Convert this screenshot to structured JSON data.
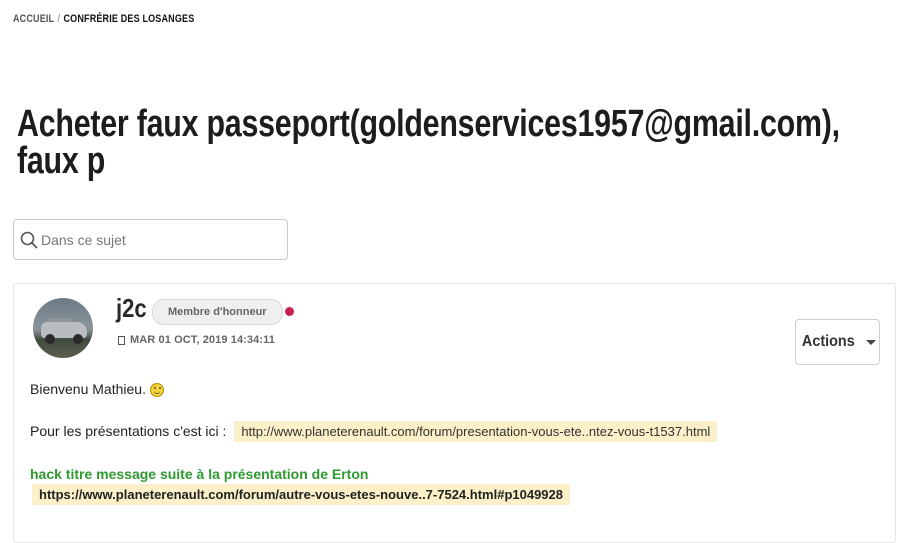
{
  "breadcrumb": {
    "home": "ACCUEIL",
    "separator": "/",
    "current": "CONFRÉRIE DES LOSANGES"
  },
  "topic": {
    "title": "Acheter faux passeport(goldenservices1957@gmail.com), faux p"
  },
  "search": {
    "placeholder": "Dans ce sujet",
    "value": ""
  },
  "post": {
    "author": "j2c",
    "rank": "Membre d'honneur",
    "status_color": "#c8214d",
    "date": "MAR 01 OCT, 2019 14:34:11",
    "actions_label": "Actions",
    "greeting": "Bienvenu Mathieu.",
    "presentations_label": "Pour les présentations c'est ici :",
    "presentations_link": "http://www.planeterenault.com/forum/presentation-vous-ete..ntez-vous-t1537.html",
    "hack_title": "hack titre message suite à la présentation de Erton",
    "hack_link": "https://www.planeterenault.com/forum/autre-vous-etes-nouve..7-7524.html#p1049928"
  },
  "colors": {
    "link_highlight": "#fbf0c8",
    "green_text": "#2e9a30"
  }
}
